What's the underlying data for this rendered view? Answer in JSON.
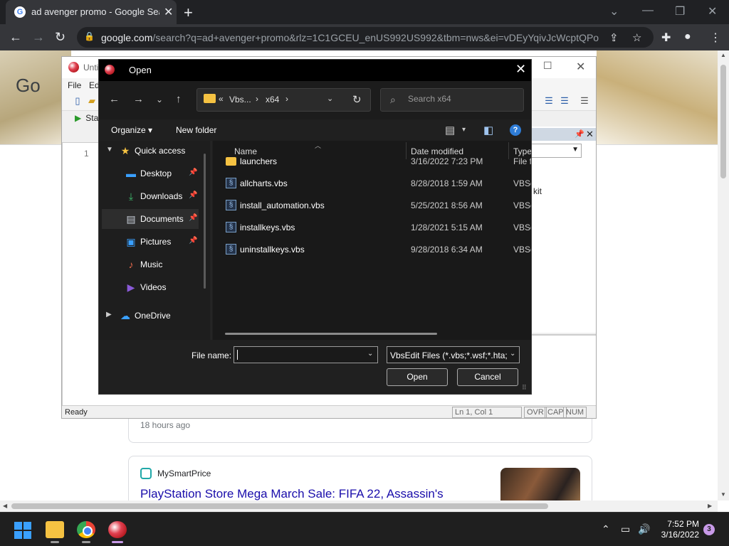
{
  "browser": {
    "tab_title": "ad avenger promo - Google Search",
    "url_host": "google.com",
    "url_rest": "/search?q=ad+avenger+promo&rlz=1C1GCEU_enUS992US992&tbm=nws&ei=vDEyYqivJcWcptQPo..."
  },
  "page": {
    "logo_fragment": "Go",
    "result1_time": "18 hours ago",
    "result2_source": "MySmartPrice",
    "result2_headline": "PlayStation Store Mega March Sale: FIFA 22, Assassin's"
  },
  "vbsedit": {
    "title": "Untit",
    "menu": [
      "File",
      "Ed"
    ],
    "start_label": "Sta",
    "line_number": "1",
    "kit_text": "kit",
    "status": {
      "ready": "Ready",
      "position": "Ln 1, Col 1",
      "ovr": "OVR",
      "cap": "CAP",
      "num": "NUM"
    }
  },
  "dialog": {
    "title": "Open",
    "breadcrumb": [
      "Vbs...",
      "x64"
    ],
    "search_placeholder": "Search x64",
    "organize_label": "Organize",
    "new_folder_label": "New folder",
    "nav_items": [
      {
        "label": "Quick access",
        "icon": "star-icon",
        "color": "#f5c242"
      },
      {
        "label": "Desktop",
        "icon": "desktop-icon",
        "color": "#3aa0ff"
      },
      {
        "label": "Downloads",
        "icon": "download-icon",
        "color": "#3fbf6f"
      },
      {
        "label": "Documents",
        "icon": "document-icon",
        "color": "#c9d0da"
      },
      {
        "label": "Pictures",
        "icon": "pictures-icon",
        "color": "#3aa0ff"
      },
      {
        "label": "Music",
        "icon": "music-icon",
        "color": "#e86a4c"
      },
      {
        "label": "Videos",
        "icon": "videos-icon",
        "color": "#8a5ad8"
      },
      {
        "label": "OneDrive",
        "icon": "cloud-icon",
        "color": "#3aa0ff"
      }
    ],
    "columns": {
      "name": "Name",
      "date": "Date modified",
      "type": "Type"
    },
    "files": [
      {
        "name": "launchers",
        "date": "3/16/2022 7:23 PM",
        "type": "File fo",
        "icon": "folder"
      },
      {
        "name": "allcharts.vbs",
        "date": "8/28/2018 1:59 AM",
        "type": "VBSc",
        "icon": "script"
      },
      {
        "name": "install_automation.vbs",
        "date": "5/25/2021 8:56 AM",
        "type": "VBSc",
        "icon": "script"
      },
      {
        "name": "installkeys.vbs",
        "date": "1/28/2021 5:15 AM",
        "type": "VBSc",
        "icon": "script"
      },
      {
        "name": "uninstallkeys.vbs",
        "date": "9/28/2018 6:34 AM",
        "type": "VBSc",
        "icon": "script"
      }
    ],
    "file_name_label": "File name:",
    "file_name_value": "",
    "file_type": "VbsEdit Files (*.vbs;*.wsf;*.hta;*",
    "open_label": "Open",
    "cancel_label": "Cancel"
  },
  "taskbar": {
    "time": "7:52 PM",
    "date": "3/16/2022",
    "notification_count": "3"
  }
}
